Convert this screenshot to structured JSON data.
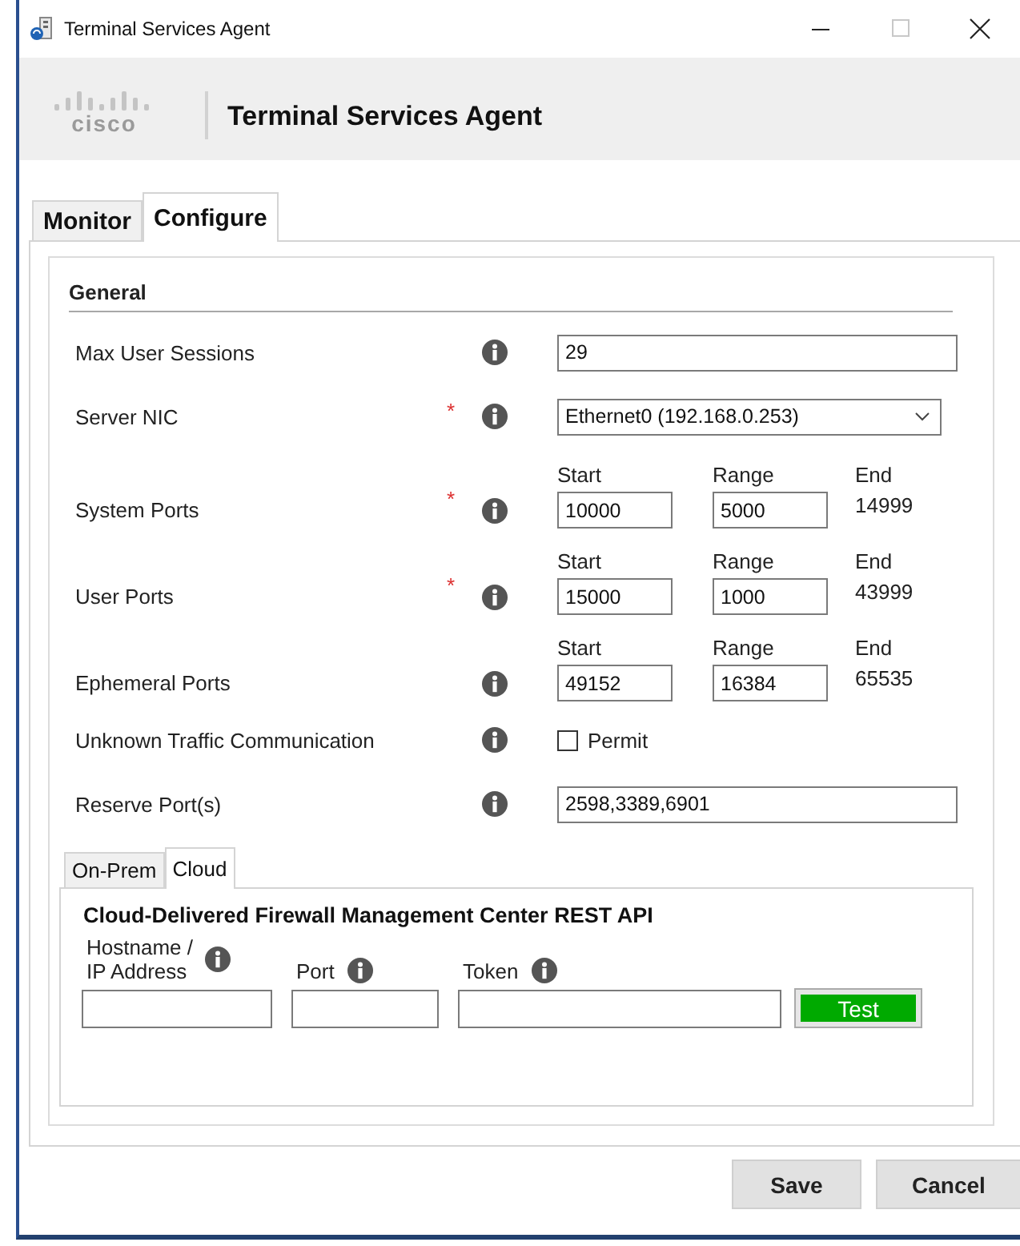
{
  "window": {
    "title": "Terminal Services Agent",
    "controls": [
      {
        "kind": "minimize",
        "disabled": false
      },
      {
        "kind": "maximize",
        "disabled": true
      },
      {
        "kind": "close",
        "disabled": false
      }
    ]
  },
  "header": {
    "logo": "cisco",
    "title": "Terminal Services Agent"
  },
  "tabs": [
    {
      "label": "Monitor",
      "selected": false
    },
    {
      "label": "Configure",
      "selected": true
    }
  ],
  "general": {
    "title": "General",
    "rows": [
      {
        "kind": "text",
        "label": "Max User Sessions",
        "value": "29"
      },
      {
        "kind": "select",
        "label": "Server NIC",
        "marker": "*",
        "value": "Ethernet0 (192.168.0.253)"
      },
      {
        "kind": "range",
        "label": "System Ports",
        "marker": "*",
        "headings": [
          "Start",
          "Range",
          "End"
        ],
        "start": "10000",
        "range": "5000",
        "end": "14999"
      },
      {
        "kind": "range",
        "label": "User Ports",
        "marker": "*",
        "headings": [
          "Start",
          "Range",
          "End"
        ],
        "start": "15000",
        "range": "1000",
        "end": "43999"
      },
      {
        "kind": "range",
        "label": "Ephemeral Ports",
        "headings": [
          "Start",
          "Range",
          "End"
        ],
        "start": "49152",
        "range": "16384",
        "end": "65535"
      },
      {
        "kind": "checkbox",
        "label": "Unknown Traffic Communication",
        "option": "Permit",
        "checked": false
      },
      {
        "kind": "text",
        "label": "Reserve Port(s)",
        "value": "2598,3389,6901"
      }
    ]
  },
  "sub_tabs": [
    {
      "label": "On-Prem",
      "selected": false
    },
    {
      "label": "Cloud",
      "selected": true
    }
  ],
  "cloud": {
    "title": "Cloud-Delivered Firewall Management Center REST API",
    "fields": [
      {
        "label": "Hostname /\nIP Address"
      },
      {
        "label": "Port"
      },
      {
        "label": "Token"
      }
    ],
    "test_button": "Test"
  },
  "buttons": [
    "Save",
    "Cancel"
  ]
}
